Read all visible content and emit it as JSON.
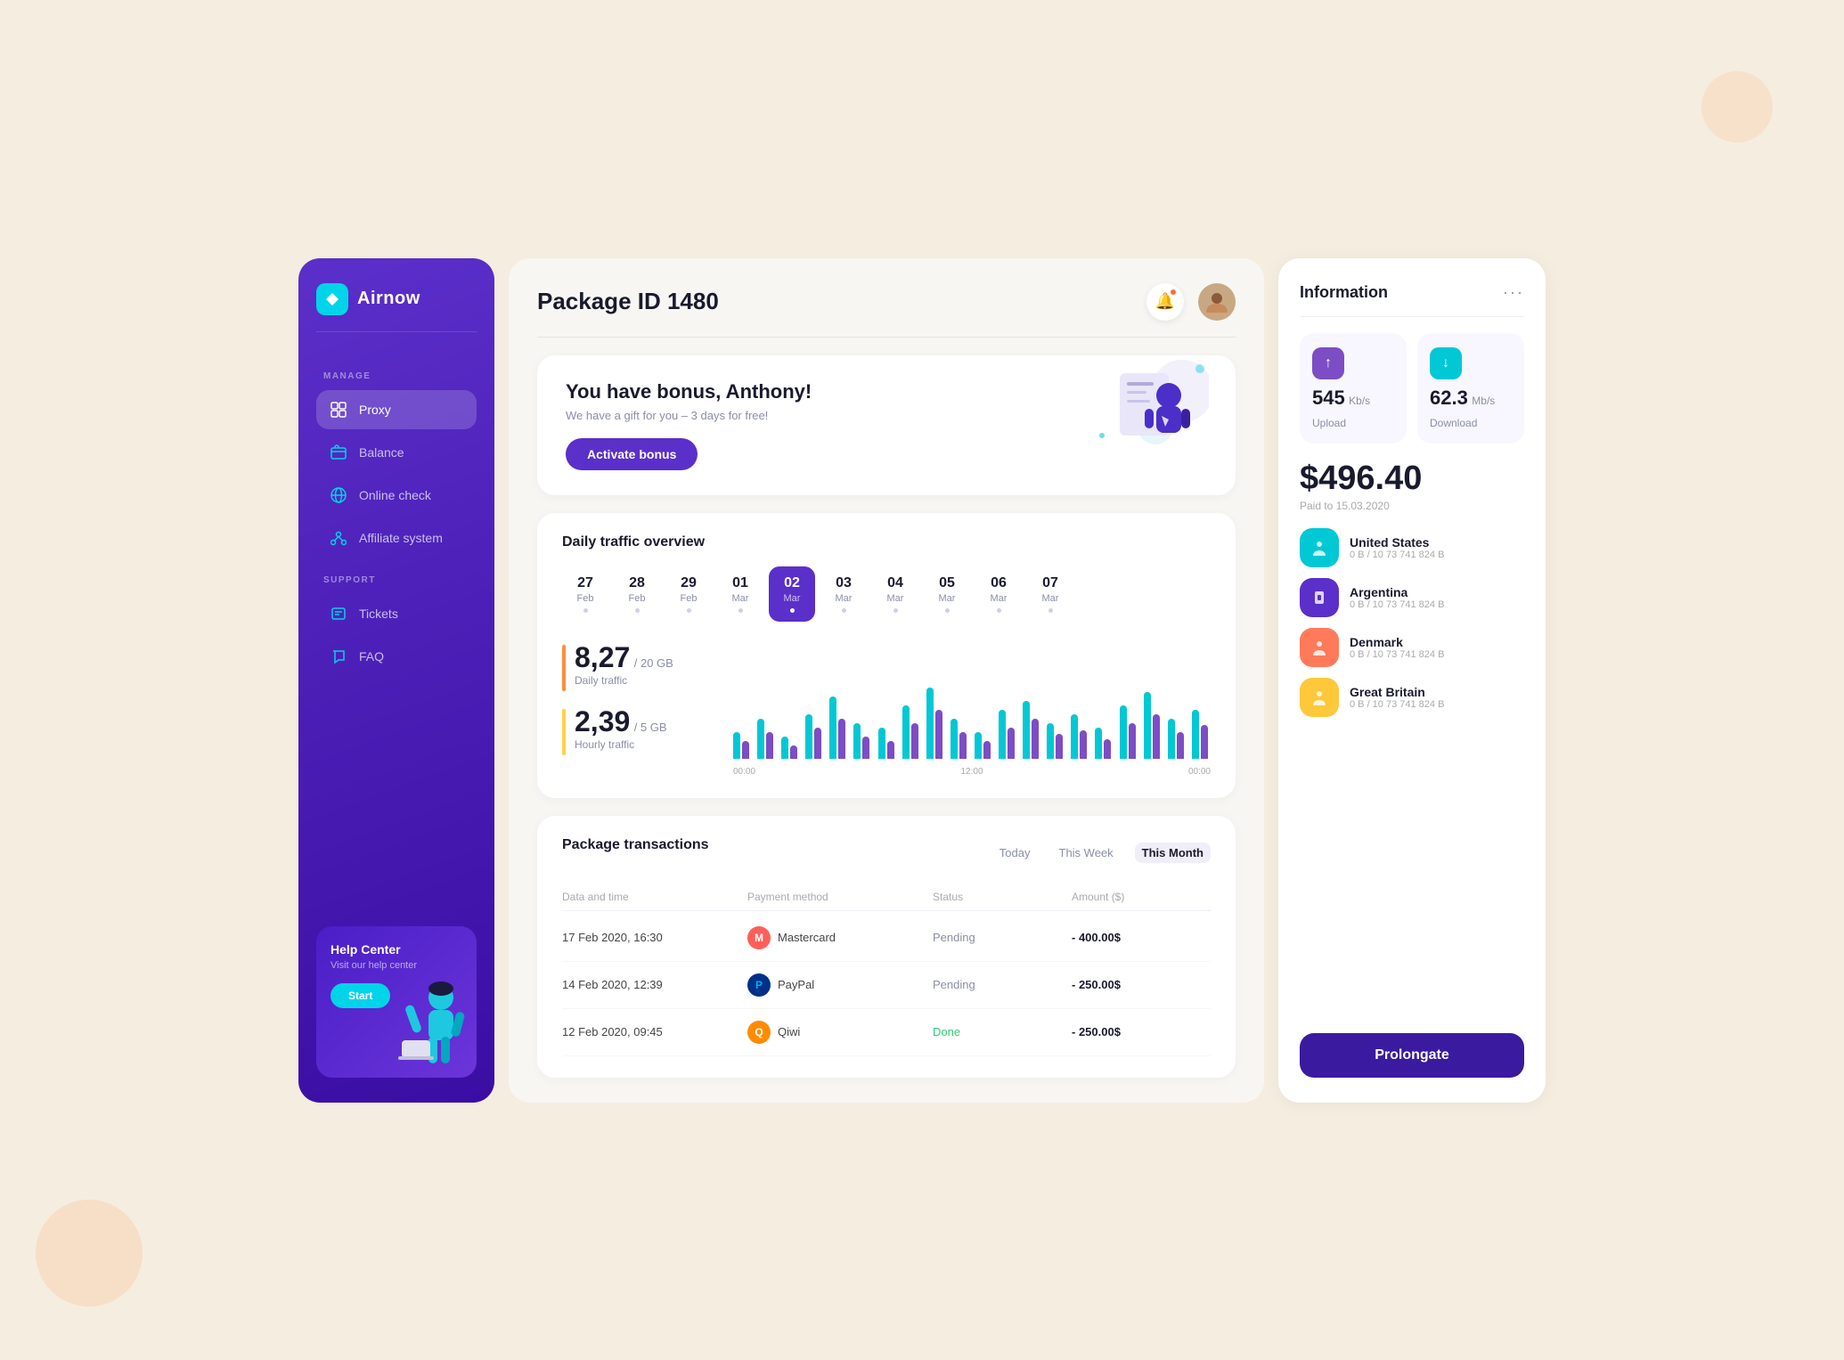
{
  "app": {
    "name": "Airnow"
  },
  "header": {
    "title": "Package ID 1480",
    "bell_label": "🔔",
    "avatar_label": "👤"
  },
  "sidebar": {
    "manage_label": "MANAGE",
    "support_label": "SUPPORT",
    "nav_items": [
      {
        "id": "proxy",
        "label": "Proxy",
        "icon": "▦",
        "active": true
      },
      {
        "id": "balance",
        "label": "Balance",
        "icon": "💳",
        "active": false
      },
      {
        "id": "online-check",
        "label": "Online check",
        "icon": "🌐",
        "active": false
      },
      {
        "id": "affiliate",
        "label": "Affiliate system",
        "icon": "🔗",
        "active": false
      }
    ],
    "support_items": [
      {
        "id": "tickets",
        "label": "Tickets",
        "icon": "📋",
        "active": false
      },
      {
        "id": "faq",
        "label": "FAQ",
        "icon": "📢",
        "active": false
      }
    ],
    "help": {
      "title": "Help Center",
      "subtitle": "Visit our help center",
      "button_label": "Start"
    }
  },
  "bonus": {
    "title": "You have bonus, Anthony!",
    "subtitle": "We have a gift for you – 3 days for free!",
    "button_label": "Activate bonus"
  },
  "traffic": {
    "section_title": "Daily traffic overview",
    "dates": [
      {
        "day": "27",
        "month": "Feb",
        "active": false
      },
      {
        "day": "28",
        "month": "Feb",
        "active": false
      },
      {
        "day": "29",
        "month": "Feb",
        "active": false
      },
      {
        "day": "01",
        "month": "Mar",
        "active": false
      },
      {
        "day": "02",
        "month": "Mar",
        "active": true
      },
      {
        "day": "03",
        "month": "Mar",
        "active": false
      },
      {
        "day": "04",
        "month": "Mar",
        "active": false
      },
      {
        "day": "05",
        "month": "Mar",
        "active": false
      },
      {
        "day": "06",
        "month": "Mar",
        "active": false
      },
      {
        "day": "07",
        "month": "Mar",
        "active": false
      }
    ],
    "daily_value": "8,27",
    "daily_limit": "/ 20 GB",
    "daily_label": "Daily traffic",
    "hourly_value": "2,39",
    "hourly_limit": "/ 5 GB",
    "hourly_label": "Hourly traffic",
    "chart_labels": [
      "00:00",
      "12:00",
      "00:00"
    ]
  },
  "transactions": {
    "section_title": "Package transactions",
    "tabs": [
      "Today",
      "This Week",
      "This Month"
    ],
    "active_tab": "This Month",
    "columns": [
      "Data and time",
      "Payment method",
      "Status",
      "Amount ($)"
    ],
    "rows": [
      {
        "date": "17 Feb 2020, 16:30",
        "method": "Mastercard",
        "method_id": "mc",
        "status": "Pending",
        "amount": "- 400.00$"
      },
      {
        "date": "14 Feb 2020, 12:39",
        "method": "PayPal",
        "method_id": "pp",
        "status": "Pending",
        "amount": "- 250.00$"
      },
      {
        "date": "12 Feb 2020, 09:45",
        "method": "Qiwi",
        "method_id": "qi",
        "status": "Done",
        "amount": "- 250.00$"
      }
    ]
  },
  "info_panel": {
    "title": "Information",
    "upload_speed": "545",
    "upload_unit": "Kb/s",
    "upload_label": "Upload",
    "download_speed": "62.3",
    "download_unit": "Mb/s",
    "download_label": "Download",
    "balance": "$496.40",
    "balance_date": "Paid to 15.03.2020",
    "countries": [
      {
        "name": "United States",
        "data": "0 B / 10 73 741 824 B",
        "color": "#00c8d4",
        "icon": "📶"
      },
      {
        "name": "Argentina",
        "data": "0 B / 10 73 741 824 B",
        "color": "#5b2fc9",
        "icon": "📱"
      },
      {
        "name": "Denmark",
        "data": "0 B / 10 73 741 824 B",
        "color": "#ff7a5a",
        "icon": "📶"
      },
      {
        "name": "Great Britain",
        "data": "0 B / 10 73 741 824 B",
        "color": "#ffc83a",
        "icon": "📶"
      }
    ],
    "prolong_label": "Prolongate"
  }
}
